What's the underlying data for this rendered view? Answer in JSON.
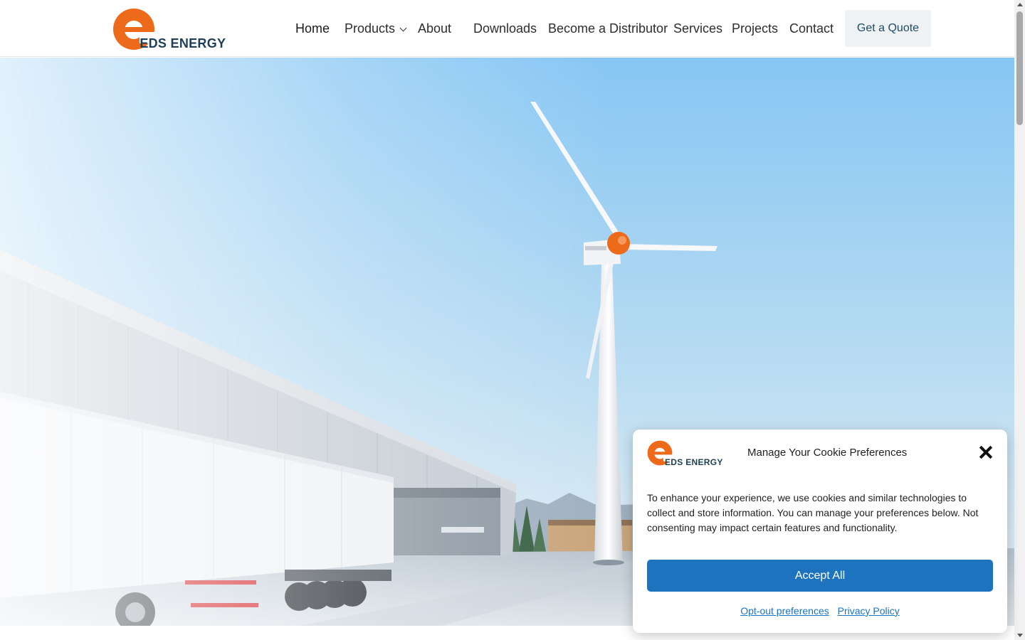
{
  "brand": {
    "name_e": "e",
    "name": "EDS ENERGY",
    "accent_orange": "#ee6a1b",
    "dark_blue": "#1f3f57"
  },
  "nav": {
    "items": [
      {
        "label": "Home"
      },
      {
        "label": "Products",
        "has_dropdown": true
      },
      {
        "label": "About"
      },
      {
        "label": "Downloads"
      },
      {
        "label": "Become a Distributor"
      },
      {
        "label": "Services"
      },
      {
        "label": "Projects"
      },
      {
        "label": "Contact"
      }
    ],
    "cta": "Get a Quote"
  },
  "hero": {
    "image_icon": "wind-turbine-warehouse-image"
  },
  "cookie": {
    "title": "Manage Your Cookie Preferences",
    "body": "To enhance your experience, we use cookies and similar technologies to collect and store information. You can manage your preferences below. Not consenting may impact certain features and functionality.",
    "accept_label": "Accept All",
    "optout_label": "Opt-out preferences",
    "privacy_label": "Privacy Policy",
    "accent_blue": "#1e73be"
  }
}
